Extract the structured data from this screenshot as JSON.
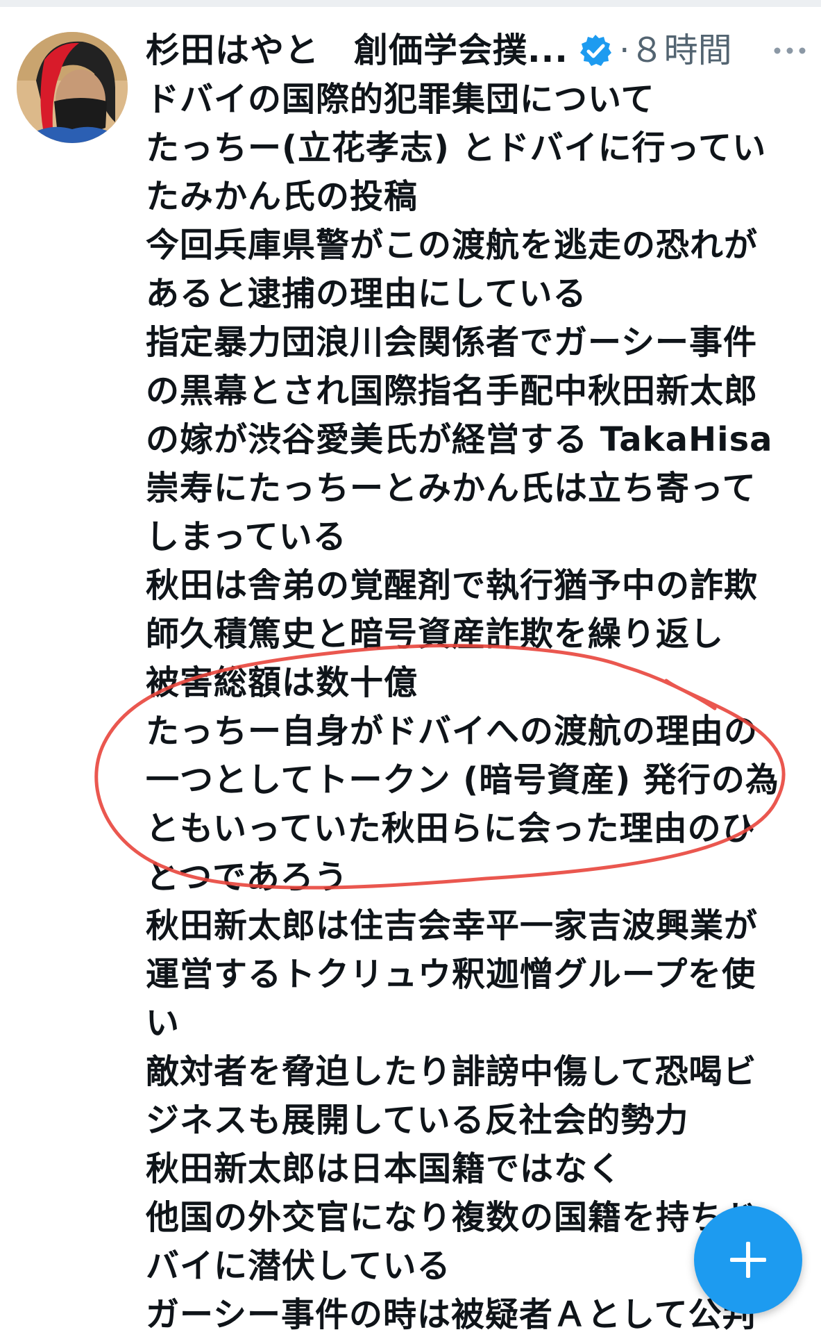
{
  "tweet": {
    "author_name": "杉田はやと　創価学会撲...",
    "timestamp": "·８時間",
    "verified_icon": "verified-badge-icon",
    "more_icon": "more-horizontal-icon",
    "lines": [
      "ドバイの国際的犯罪集団について",
      "たっちー(立花孝志) とドバイに行ってい",
      "たみかん氏の投稿",
      "今回兵庫県警がこの渡航を逃走の恐れが",
      "あると逮捕の理由にしている",
      "指定暴力団浪川会関係者でガーシー事件",
      "の黒幕とされ国際指名手配中秋田新太郎",
      "の嫁が渋谷愛美氏が経営する TakaHisa",
      "崇寿にたっちーとみかん氏は立ち寄って",
      "しまっている",
      "秋田は舎弟の覚醒剤で執行猶予中の詐欺",
      "師久積篤史と暗号資産詐欺を繰り返し",
      "被害総額は数十億",
      "たっちー自身がドバイへの渡航の理由の",
      "一つとしてトークン (暗号資産) 発行の為",
      "ともいっていた秋田らに会った理由のひ",
      "とつであろう",
      "秋田新太郎は住吉会幸平一家吉波興業が",
      "運営するトクリュウ釈迦憎グループを使",
      "い",
      "敵対者を脅迫したり誹謗中傷して恐喝ビ",
      "ジネスも展開している反社会的勢力",
      "秋田新太郎は日本国籍ではなく",
      "他国の外交官になり複数の国籍を持ちド",
      "バイに潜伏している",
      "ガーシー事件の時は被疑者Ａとして公判"
    ]
  },
  "annotation": {
    "color": "#e8453c"
  },
  "fab": {
    "icon": "plus-icon",
    "color": "#1d9bf0"
  }
}
